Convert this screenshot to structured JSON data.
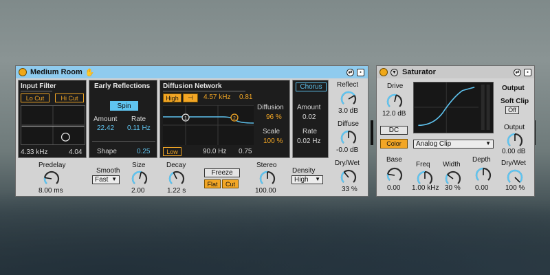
{
  "reverb": {
    "title": "Medium Room",
    "input_filter": {
      "title": "Input Filter",
      "lo_cut": "Lo Cut",
      "hi_cut": "Hi Cut",
      "freq": "4.33 kHz",
      "width": "4.04"
    },
    "early_reflections": {
      "title": "Early Reflections",
      "spin": "Spin",
      "amount_label": "Amount",
      "amount": "22.42",
      "rate_label": "Rate",
      "rate": "0.11 Hz",
      "shape_label": "Shape",
      "shape": "0.25"
    },
    "diffusion_network": {
      "title": "Diffusion Network",
      "high": "High",
      "high_freq": "4.57 kHz",
      "high_val": "0.81",
      "low": "Low",
      "low_freq": "90.0 Hz",
      "low_val": "0.75",
      "diffusion_label": "Diffusion",
      "diffusion": "96 %",
      "scale_label": "Scale",
      "scale": "100 %"
    },
    "chorus": {
      "title": "Chorus",
      "amount_label": "Amount",
      "amount": "0.02",
      "rate_label": "Rate",
      "rate": "0.02 Hz"
    },
    "right": {
      "reflect_label": "Reflect",
      "reflect": "3.0 dB",
      "diffuse_label": "Diffuse",
      "diffuse": "-0.0 dB",
      "drywet_label": "Dry/Wet",
      "drywet": "33 %"
    },
    "bottom": {
      "predelay_label": "Predelay",
      "predelay": "8.00 ms",
      "smooth_label": "Smooth",
      "smooth": "Fast",
      "size_label": "Size",
      "size": "2.00",
      "decay_label": "Decay",
      "decay": "1.22 s",
      "freeze": "Freeze",
      "flat": "Flat",
      "cut": "Cut",
      "stereo_label": "Stereo",
      "stereo": "100.00",
      "density_label": "Density",
      "density": "High"
    }
  },
  "saturator": {
    "title": "Saturator",
    "drive_label": "Drive",
    "drive": "12.0 dB",
    "dc": "DC",
    "color": "Color",
    "curve": "Analog Clip",
    "output_title": "Output",
    "soft_clip_label": "Soft Clip",
    "soft_clip": "Off",
    "output_label": "Output",
    "output": "0.00 dB",
    "drywet_label": "Dry/Wet",
    "drywet": "100 %",
    "base_label": "Base",
    "base": "0.00",
    "freq_label": "Freq",
    "freq": "1.00 kHz",
    "width_label": "Width",
    "width": "30 %",
    "depth_label": "Depth",
    "depth": "0.00"
  },
  "colors": {
    "accent_orange": "#f2a625",
    "accent_blue": "#5fc4f0",
    "titlebar_blue": "#8fcbee",
    "titlebar_gray": "#c9c9c9"
  },
  "knob_levels": {
    "reflect": 0.72,
    "diffuse": 0.5,
    "reverb_drywet": 0.35,
    "predelay": 0.2,
    "size": 0.55,
    "decay": 0.4,
    "stereo": 0.5,
    "drive": 0.55,
    "sat_output": 0.5,
    "sat_drywet": 1.0,
    "base": 0.2,
    "freq": 0.5,
    "width": 0.3,
    "depth": 0.5
  }
}
